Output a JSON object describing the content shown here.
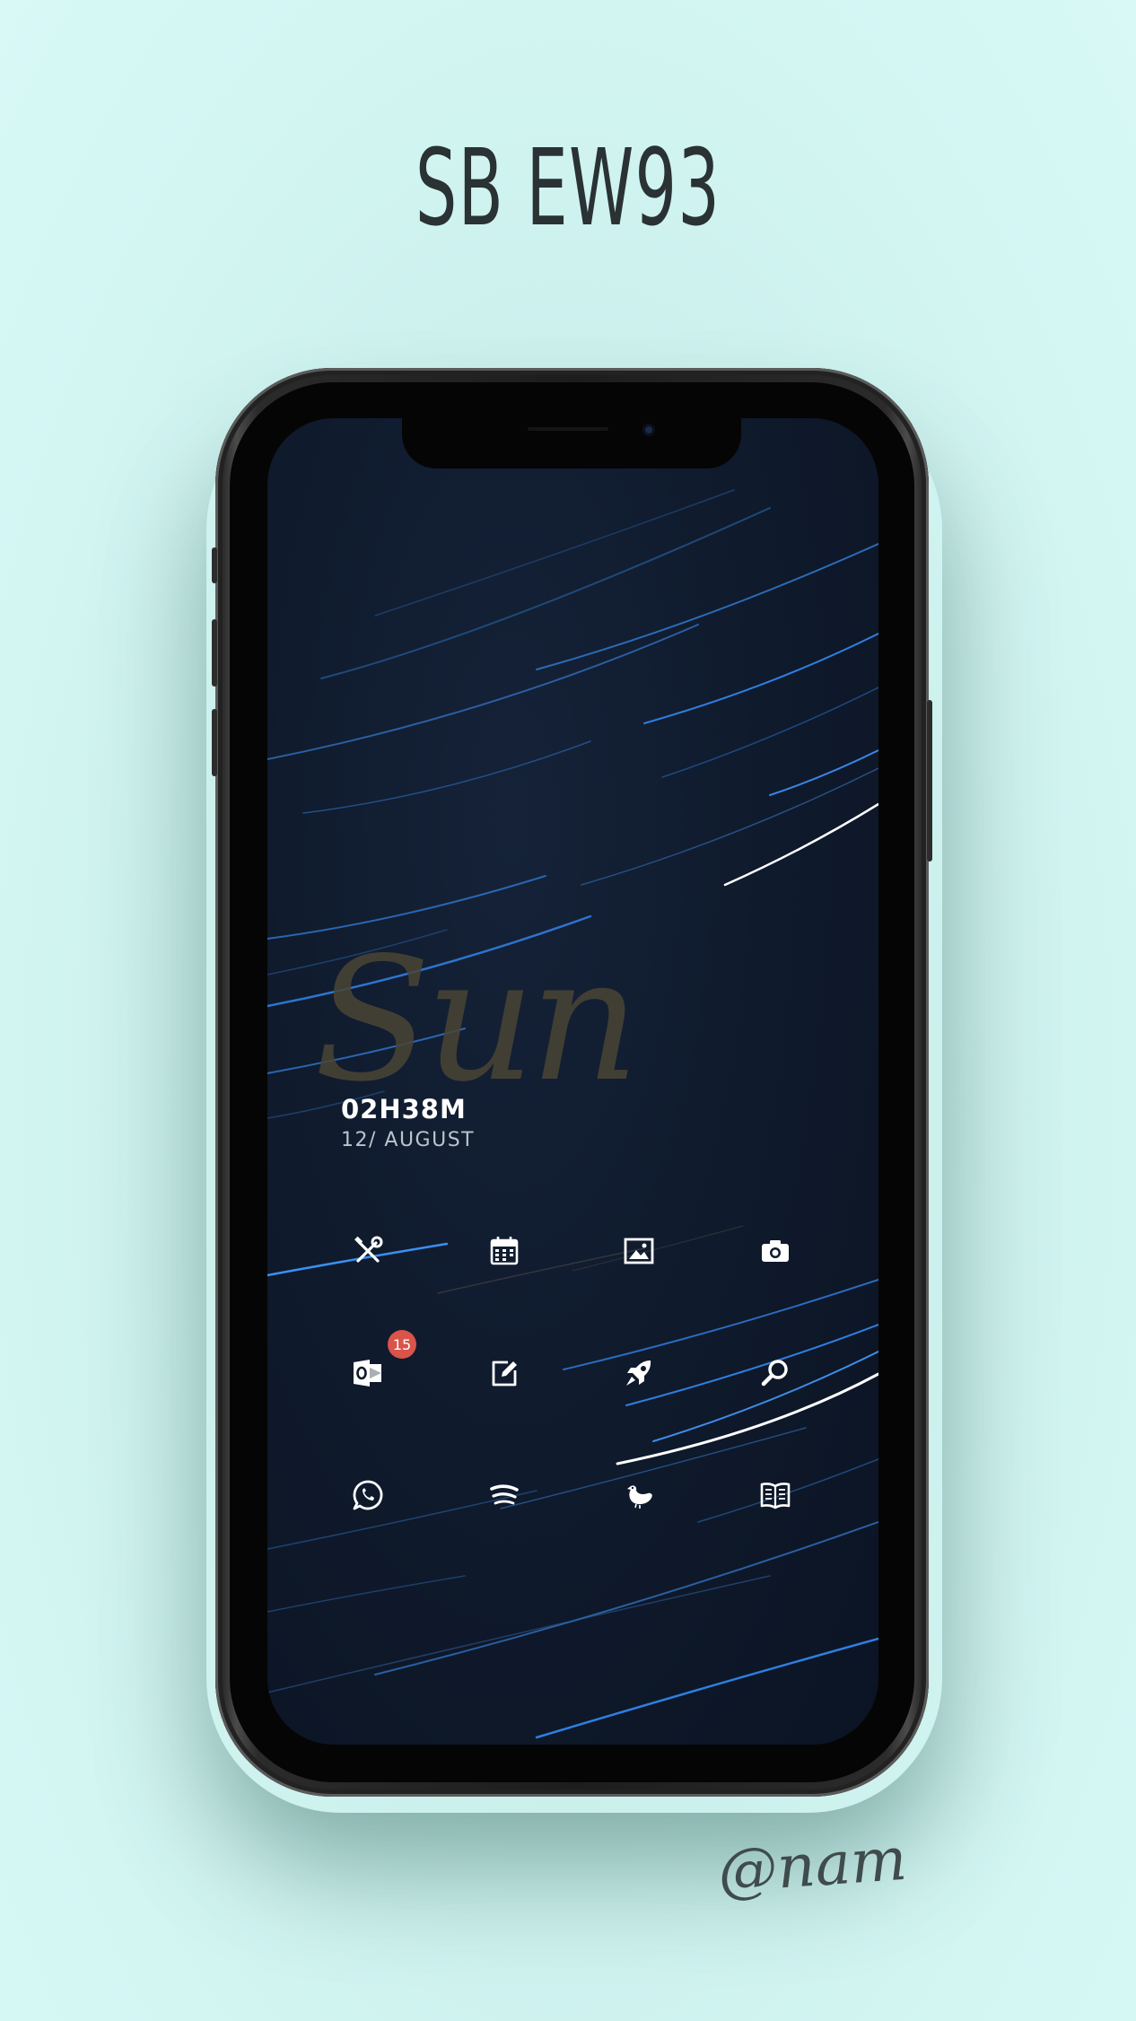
{
  "page": {
    "title": "SB EW93",
    "watermark": "@nam"
  },
  "lockscreen": {
    "day_word": "Sun",
    "time": "02H38M",
    "date": "12/ AUGUST"
  },
  "apps": [
    {
      "icon": "tools-icon"
    },
    {
      "icon": "calendar-icon"
    },
    {
      "icon": "gallery-icon"
    },
    {
      "icon": "camera-icon"
    },
    {
      "icon": "outlook-icon",
      "badge": "15"
    },
    {
      "icon": "note-edit-icon"
    },
    {
      "icon": "rocket-icon"
    },
    {
      "icon": "search-icon"
    },
    {
      "icon": "whatsapp-icon"
    },
    {
      "icon": "spotify-icon"
    },
    {
      "icon": "bird-icon"
    },
    {
      "icon": "book-icon"
    }
  ],
  "colors": {
    "background": "#d3f6f3",
    "screen": "#0f1a2c",
    "badge": "#d9544a",
    "trail": "#2f7fe0"
  }
}
